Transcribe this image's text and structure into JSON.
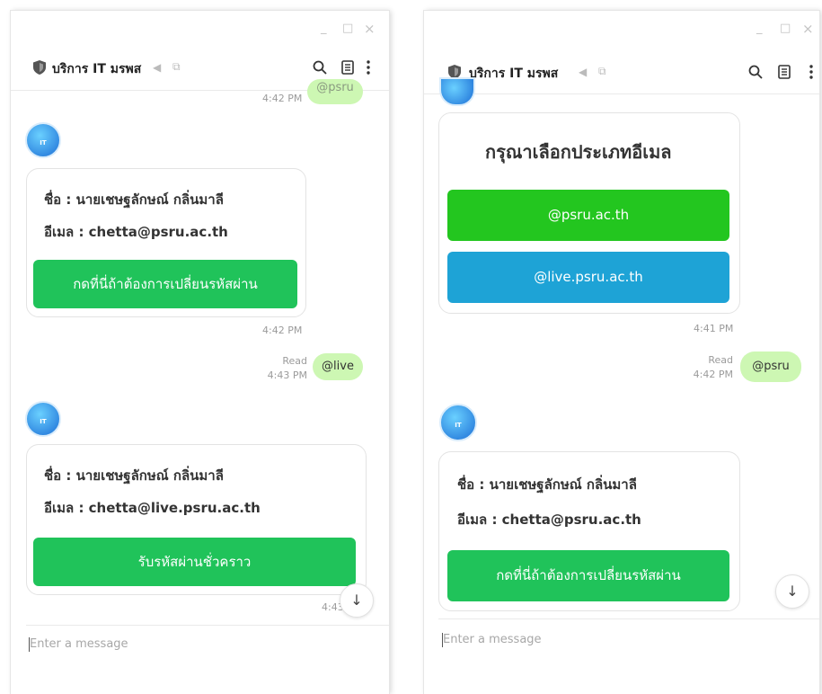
{
  "left": {
    "window_controls": {
      "minimize": "_",
      "maximize": "□",
      "close": "×"
    },
    "header": {
      "title": "บริการ IT มรพส",
      "mute_icon": "speaker-muted-icon",
      "share_icon": "external-link-icon"
    },
    "top_bubble": {
      "time": "4:42 PM",
      "text": "@psru"
    },
    "card1": {
      "name_line": "ชื่อ : นายเชษฐลักษณ์ กลิ่นมาลี",
      "email_line": "อีเมล : chetta@psru.ac.th",
      "button": "กดที่นี่ถ้าต้องการเปลี่ยนรหัสผ่าน",
      "time": "4:42 PM"
    },
    "reply": {
      "read": "Read",
      "time": "4:43 PM",
      "text": "@live"
    },
    "card2": {
      "name_line": "ชื่อ : นายเชษฐลักษณ์ กลิ่นมาลี",
      "email_line": "อีเมล : chetta@live.psru.ac.th",
      "button": "รับรหัสผ่านชั่วคราว",
      "time": "4:43"
    },
    "scroll_down": "↓",
    "input_placeholder": "Enter a message"
  },
  "right": {
    "window_controls": {
      "minimize": "_",
      "maximize": "□",
      "close": "×"
    },
    "header": {
      "title": "บริการ IT มรพส",
      "mute_icon": "speaker-muted-icon",
      "share_icon": "external-link-icon"
    },
    "menu_card": {
      "title": "กรุณาเลือกประเภทอีเมล",
      "option1": "@psru.ac.th",
      "option2": "@live.psru.ac.th",
      "time": "4:41 PM"
    },
    "reply": {
      "read": "Read",
      "time": "4:42 PM",
      "text": "@psru"
    },
    "card": {
      "name_line": "ชื่อ : นายเชษฐลักษณ์ กลิ่นมาลี",
      "email_line": "อีเมล : chetta@psru.ac.th",
      "button": "กดที่นี่ถ้าต้องการเปลี่ยนรหัสผ่าน"
    },
    "scroll_down": "↓",
    "input_placeholder": "Enter a message"
  },
  "colors": {
    "green_button": "#20c35a",
    "bright_green": "#23c61f",
    "blue_button": "#1ea3d6",
    "bubble": "#cdf7b3"
  }
}
